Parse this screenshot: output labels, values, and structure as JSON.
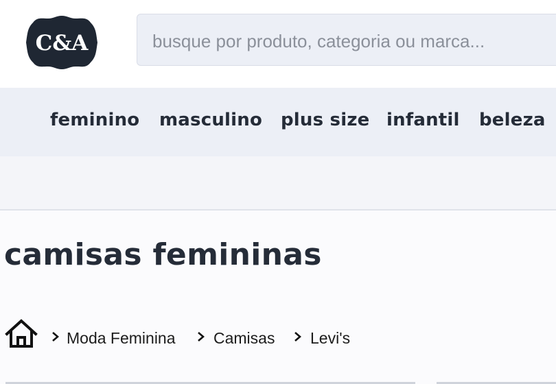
{
  "brand": {
    "logo_text": "C&A",
    "logo_color": "#1f2733"
  },
  "search": {
    "placeholder": "busque por produto, categoria ou marca..."
  },
  "nav": {
    "items": [
      {
        "label": "feminino"
      },
      {
        "label": "masculino"
      },
      {
        "label": "plus size"
      },
      {
        "label": "infantil"
      },
      {
        "label": "beleza"
      }
    ]
  },
  "page": {
    "title": "camisas femininas"
  },
  "breadcrumb": {
    "home_icon": "home-icon",
    "items": [
      {
        "label": "Moda Feminina"
      },
      {
        "label": "Camisas"
      },
      {
        "label": "Levi's"
      }
    ]
  },
  "colors": {
    "nav_background": "#eceff6",
    "text_dark": "#252c38",
    "placeholder": "#8b909a"
  }
}
